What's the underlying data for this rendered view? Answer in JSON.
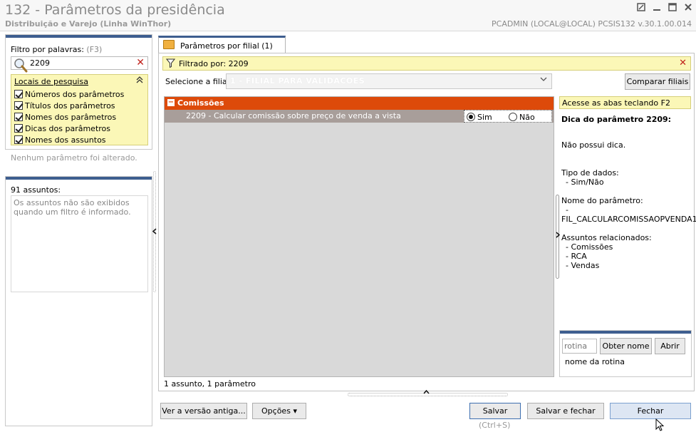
{
  "window": {
    "title": "132 - Parâmetros da presidência",
    "subtitle": "Distribuição e Varejo (Linha WinThor)",
    "user_info": "PCADMIN (LOCAL@LOCAL)   PCSIS132  v.30.1.00.014",
    "controls": [
      "restore-icon",
      "minimize-icon",
      "maximize-icon",
      "close-icon"
    ]
  },
  "filter": {
    "label": "Filtro por palavras:",
    "shortcut": "(F3)",
    "value": "2209",
    "locais_title": "Locais de pesquisa",
    "locais": [
      {
        "label": "Números dos parâmetros",
        "checked": true
      },
      {
        "label": "Títulos dos parâmetros",
        "checked": true
      },
      {
        "label": "Nomes dos parâmetros",
        "checked": true
      },
      {
        "label": "Dicas dos parâmetros",
        "checked": true
      },
      {
        "label": "Nomes dos assuntos",
        "checked": true
      }
    ],
    "no_change_text": "Nenhum parâmetro foi alterado."
  },
  "topics": {
    "label": "91 assuntos:",
    "note": "Os assuntos não são exibidos quando um filtro é informado."
  },
  "tab": {
    "label": "Parâmetros por filial  (1)"
  },
  "filter_bar": {
    "text": "Filtrado por: 2209"
  },
  "filial": {
    "label": "Selecione a filial:",
    "value": "1 - FILIAL PARA VALIDACOES",
    "compare_button": "Comparar filiais"
  },
  "grid": {
    "group": "Comissões",
    "param_label": "2209 - Calcular comissão sobre preço de venda a vista",
    "option_yes": "Sim",
    "option_no": "Não",
    "selected": "Sim",
    "status": "1 assunto, 1 parâmetro"
  },
  "help": {
    "hint": "Acesse as abas teclando F2",
    "title": "Dica do parâmetro 2209:",
    "no_tip": "Não possui dica.",
    "data_type_label": "Tipo de dados:",
    "data_type_value": "- Sim/Não",
    "param_name_label": "Nome do parâmetro:",
    "param_name_dash": "-",
    "param_name_value": "FIL_CALCULARCOMISSAOPVENDA1",
    "related_label": "Assuntos relacionados:",
    "related": [
      "- Comissões",
      "- RCA",
      "- Vendas"
    ]
  },
  "rotina": {
    "placeholder": "rotina",
    "get_name_button": "Obter nome",
    "open_button": "Abrir",
    "name_label": "nome da rotina"
  },
  "footer": {
    "old_version_button": "Ver a versão antiga...",
    "options_button": "Opções",
    "save_button": "Salvar",
    "save_shortcut": "(Ctrl+S)",
    "save_close_button": "Salvar e fechar",
    "close_button": "Fechar"
  }
}
